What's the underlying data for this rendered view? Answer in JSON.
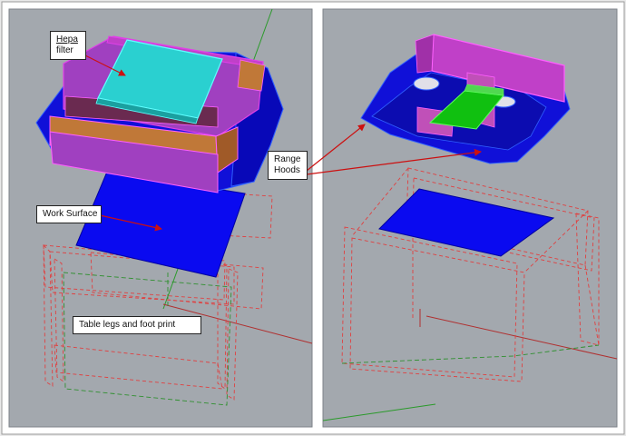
{
  "labels": {
    "hepa_filter": {
      "line1": "Hepa",
      "line2": "filter"
    },
    "range_hoods": {
      "line1": "Range",
      "line2": "Hoods"
    },
    "work_surface": "Work Surface",
    "table_legs": "Table legs and foot print"
  },
  "colors": {
    "frame_border": "#9a9a9a",
    "viewport_bg": "#a3a8ae",
    "hood_blue": "#1010d8",
    "work_surface_blue": "#0a0af0",
    "hepa_cyan": "#2ad0d0",
    "purple": "#a040c0",
    "magenta_top": "#c040c8",
    "orange": "#c07838",
    "green": "#10c010",
    "dashed_red": "#e04040",
    "dashed_green": "#309030",
    "arrow_red": "#cc1010"
  }
}
